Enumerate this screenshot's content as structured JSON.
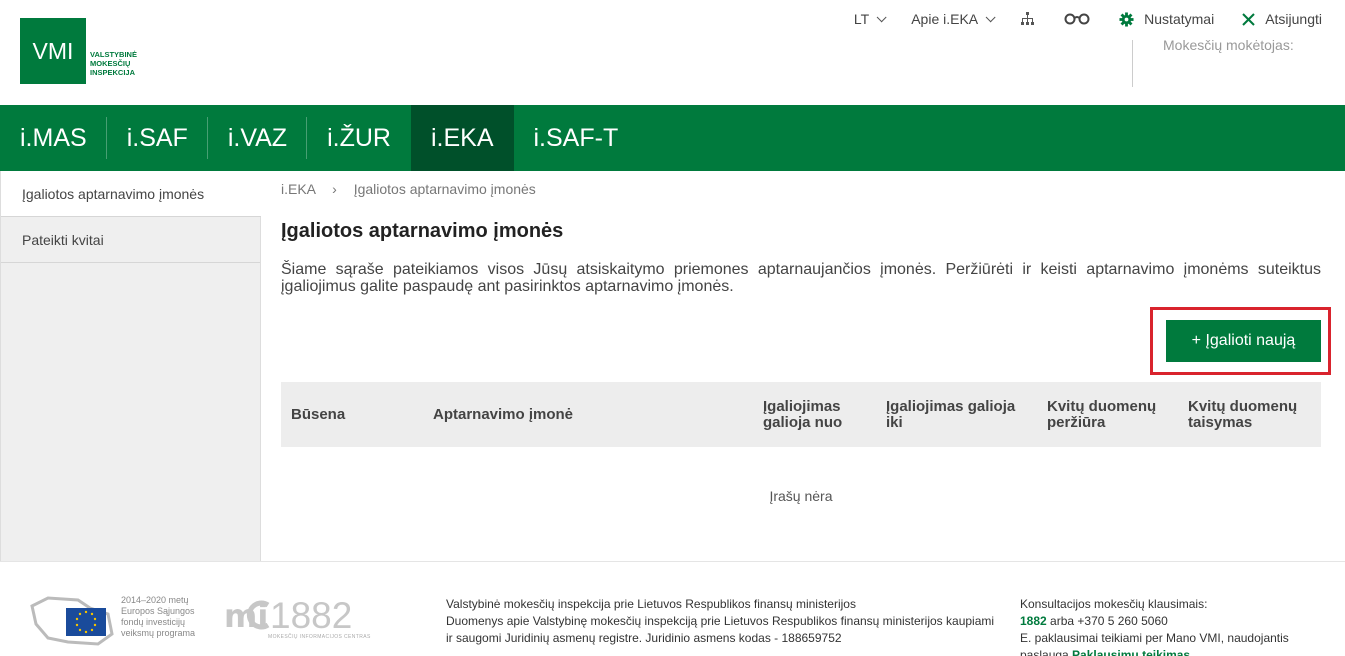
{
  "header": {
    "logo_text": "VMI",
    "logo_subtitle": [
      "VALSTYBINĖ",
      "MOKESČIŲ",
      "INSPEKCIJA"
    ],
    "language": "LT",
    "about": "Apie i.EKA",
    "settings": "Nustatymai",
    "logout": "Atsijungti",
    "taxpayer_label": "Mokesčių mokėtojas:"
  },
  "main_nav": [
    {
      "label": "i.MAS"
    },
    {
      "label": "i.SAF"
    },
    {
      "label": "i.VAZ"
    },
    {
      "label": "i.ŽUR"
    },
    {
      "label": "i.EKA",
      "active": true
    },
    {
      "label": "i.SAF-T"
    }
  ],
  "sidebar": {
    "items": [
      {
        "label": "Įgaliotos aptarnavimo įmonės",
        "active": true
      },
      {
        "label": "Pateikti kvitai"
      }
    ]
  },
  "breadcrumb": [
    "i.EKA",
    "Įgaliotos aptarnavimo įmonės"
  ],
  "breadcrumb_sep": "›",
  "page": {
    "title": "Įgaliotos aptarnavimo įmonės",
    "description": "Šiame sąraše pateikiamos visos Jūsų atsiskaitymo priemones aptarnaujančios įmonės. Peržiūrėti ir keisti aptarnavimo įmonėms suteiktus įgaliojimus galite paspaudę ant pasirinktos aptarnavimo įmonės.",
    "add_button": "+ Įgalioti naują"
  },
  "table": {
    "columns": [
      {
        "label": "Būsena"
      },
      {
        "label": "Aptarnavimo įmonė"
      },
      {
        "label": "Įgaliojimas galioja nuo"
      },
      {
        "label": "Įgaliojimas galioja iki"
      },
      {
        "label": "Kvitų duomenų peržiūra"
      },
      {
        "label": "Kvitų duomenų taisymas"
      }
    ],
    "empty_text": "Įrašų nėra"
  },
  "footer": {
    "eu_text": [
      "2014–2020 metų",
      "Europos Sąjungos",
      "fondų investicijų",
      "veiksmų programa"
    ],
    "mic_text": "1882",
    "mic_subtext": "MOKESČIŲ INFORMACIJOS CENTRAS",
    "mid_lines": [
      "Valstybinė mokesčių inspekcija prie Lietuvos Respublikos finansų ministerijos",
      "Duomenys apie Valstybinę mokesčių inspekciją prie Lietuvos Respublikos finansų ministerijos kaupiami",
      "ir saugomi Juridinių asmenų registre. Juridinio asmens kodas - 188659752"
    ],
    "right_title": "Konsultacijos mokesčių klausimais:",
    "phone_short": "1882",
    "phone_rest": " arba +370 5 260 5060",
    "right_line3": "E. paklausimai teikiami per Mano VMI, naudojantis",
    "right_line4_prefix": "paslauga ",
    "right_line4_link": "Paklausimų teikimas"
  },
  "colors": {
    "brand_green": "#007a3d",
    "active_nav": "#00502a",
    "highlight": "#d9232d"
  }
}
